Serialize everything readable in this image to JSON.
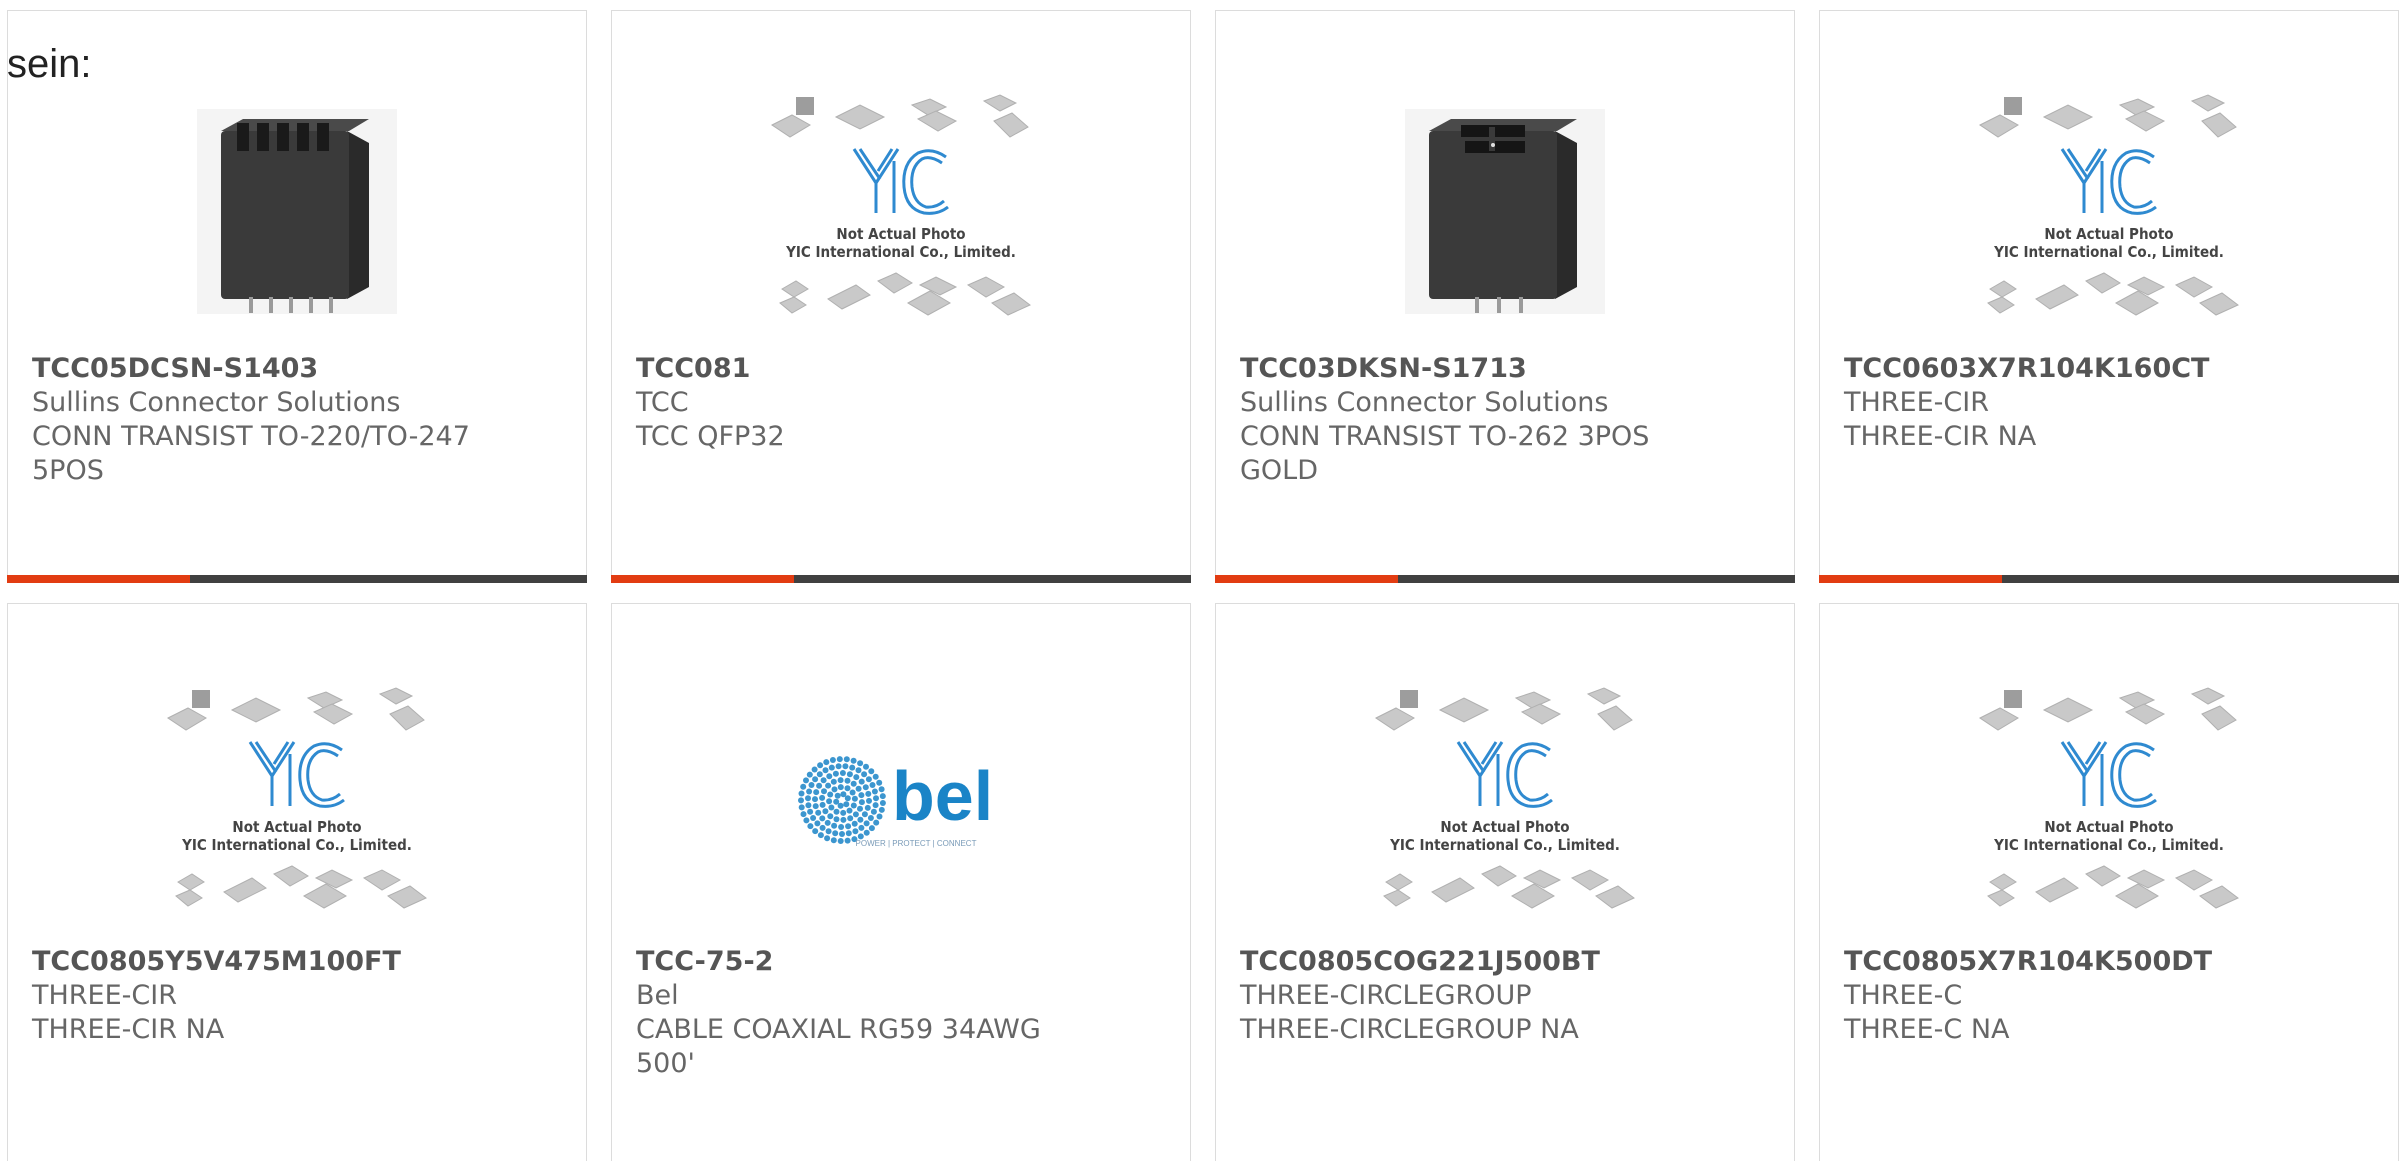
{
  "page": {
    "lead_text": "sein:"
  },
  "colors": {
    "accent_bar": "#e23c12",
    "bar_rest": "#404040",
    "card_border": "#dcdcdc",
    "yic_blue": "#2f8ad0",
    "bel_blue": "#1a84c7"
  },
  "placeholder": {
    "line1": "Not Actual Photo",
    "line2": "YIC International Co., Limited."
  },
  "bel_logo": {
    "word": "bel",
    "tagline": "POWER | PROTECT | CONNECT"
  },
  "products": [
    {
      "part": "TCC05DCSN-S1403",
      "maker": "Sullins Connector Solutions",
      "desc": "CONN TRANSIST TO-220/TO-247 5POS",
      "image": "connector-5pos"
    },
    {
      "part": "TCC081",
      "maker": "TCC",
      "desc": "TCC QFP32",
      "image": "yic-placeholder"
    },
    {
      "part": "TCC03DKSN-S1713",
      "maker": "Sullins Connector Solutions",
      "desc": "CONN TRANSIST TO-262 3POS GOLD",
      "image": "connector-3pos"
    },
    {
      "part": "TCC0603X7R104K160CT",
      "maker": "THREE-CIR",
      "desc": "THREE-CIR NA",
      "image": "yic-placeholder"
    },
    {
      "part": "TCC0805Y5V475M100FT",
      "maker": "THREE-CIR",
      "desc": "THREE-CIR NA",
      "image": "yic-placeholder"
    },
    {
      "part": "TCC-75-2",
      "maker": "Bel",
      "desc": "CABLE COAXIAL RG59 34AWG 500'",
      "image": "bel-logo"
    },
    {
      "part": "TCC0805COG221J500BT",
      "maker": "THREE-CIRCLEGROUP",
      "desc": "THREE-CIRCLEGROUP NA",
      "image": "yic-placeholder"
    },
    {
      "part": "TCC0805X7R104K500DT",
      "maker": "THREE-C",
      "desc": "THREE-C NA",
      "image": "yic-placeholder"
    }
  ]
}
